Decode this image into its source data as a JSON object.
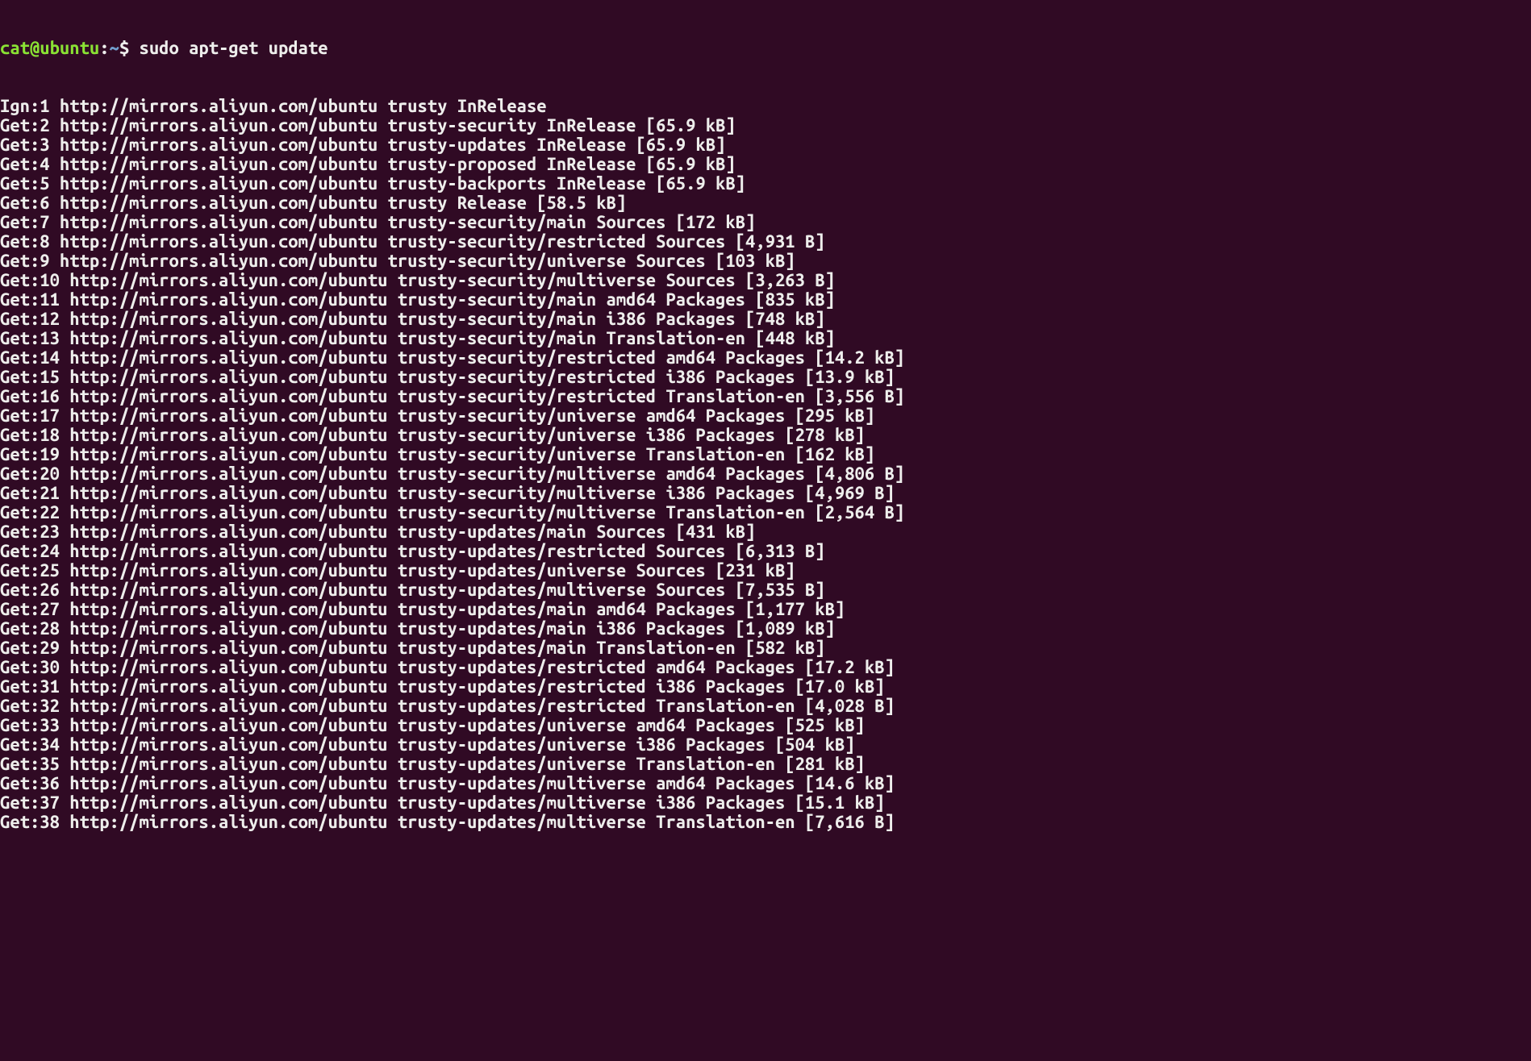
{
  "prompt": {
    "user": "cat",
    "at": "@",
    "host": "ubuntu",
    "colon": ":",
    "path": "~",
    "dollar": "$ ",
    "command": "sudo apt-get update"
  },
  "lines": [
    "Ign:1 http://mirrors.aliyun.com/ubuntu trusty InRelease",
    "Get:2 http://mirrors.aliyun.com/ubuntu trusty-security InRelease [65.9 kB]",
    "Get:3 http://mirrors.aliyun.com/ubuntu trusty-updates InRelease [65.9 kB]",
    "Get:4 http://mirrors.aliyun.com/ubuntu trusty-proposed InRelease [65.9 kB]",
    "Get:5 http://mirrors.aliyun.com/ubuntu trusty-backports InRelease [65.9 kB]",
    "Get:6 http://mirrors.aliyun.com/ubuntu trusty Release [58.5 kB]",
    "Get:7 http://mirrors.aliyun.com/ubuntu trusty-security/main Sources [172 kB]",
    "Get:8 http://mirrors.aliyun.com/ubuntu trusty-security/restricted Sources [4,931 B]",
    "Get:9 http://mirrors.aliyun.com/ubuntu trusty-security/universe Sources [103 kB]",
    "Get:10 http://mirrors.aliyun.com/ubuntu trusty-security/multiverse Sources [3,263 B]",
    "Get:11 http://mirrors.aliyun.com/ubuntu trusty-security/main amd64 Packages [835 kB]",
    "Get:12 http://mirrors.aliyun.com/ubuntu trusty-security/main i386 Packages [748 kB]",
    "Get:13 http://mirrors.aliyun.com/ubuntu trusty-security/main Translation-en [448 kB]",
    "Get:14 http://mirrors.aliyun.com/ubuntu trusty-security/restricted amd64 Packages [14.2 kB]",
    "Get:15 http://mirrors.aliyun.com/ubuntu trusty-security/restricted i386 Packages [13.9 kB]",
    "Get:16 http://mirrors.aliyun.com/ubuntu trusty-security/restricted Translation-en [3,556 B]",
    "Get:17 http://mirrors.aliyun.com/ubuntu trusty-security/universe amd64 Packages [295 kB]",
    "Get:18 http://mirrors.aliyun.com/ubuntu trusty-security/universe i386 Packages [278 kB]",
    "Get:19 http://mirrors.aliyun.com/ubuntu trusty-security/universe Translation-en [162 kB]",
    "Get:20 http://mirrors.aliyun.com/ubuntu trusty-security/multiverse amd64 Packages [4,806 B]",
    "Get:21 http://mirrors.aliyun.com/ubuntu trusty-security/multiverse i386 Packages [4,969 B]",
    "Get:22 http://mirrors.aliyun.com/ubuntu trusty-security/multiverse Translation-en [2,564 B]",
    "Get:23 http://mirrors.aliyun.com/ubuntu trusty-updates/main Sources [431 kB]",
    "Get:24 http://mirrors.aliyun.com/ubuntu trusty-updates/restricted Sources [6,313 B]",
    "Get:25 http://mirrors.aliyun.com/ubuntu trusty-updates/universe Sources [231 kB]",
    "Get:26 http://mirrors.aliyun.com/ubuntu trusty-updates/multiverse Sources [7,535 B]",
    "Get:27 http://mirrors.aliyun.com/ubuntu trusty-updates/main amd64 Packages [1,177 kB]",
    "Get:28 http://mirrors.aliyun.com/ubuntu trusty-updates/main i386 Packages [1,089 kB]",
    "Get:29 http://mirrors.aliyun.com/ubuntu trusty-updates/main Translation-en [582 kB]",
    "Get:30 http://mirrors.aliyun.com/ubuntu trusty-updates/restricted amd64 Packages [17.2 kB]",
    "Get:31 http://mirrors.aliyun.com/ubuntu trusty-updates/restricted i386 Packages [17.0 kB]",
    "Get:32 http://mirrors.aliyun.com/ubuntu trusty-updates/restricted Translation-en [4,028 B]",
    "Get:33 http://mirrors.aliyun.com/ubuntu trusty-updates/universe amd64 Packages [525 kB]",
    "Get:34 http://mirrors.aliyun.com/ubuntu trusty-updates/universe i386 Packages [504 kB]",
    "Get:35 http://mirrors.aliyun.com/ubuntu trusty-updates/universe Translation-en [281 kB]",
    "Get:36 http://mirrors.aliyun.com/ubuntu trusty-updates/multiverse amd64 Packages [14.6 kB]",
    "Get:37 http://mirrors.aliyun.com/ubuntu trusty-updates/multiverse i386 Packages [15.1 kB]",
    "Get:38 http://mirrors.aliyun.com/ubuntu trusty-updates/multiverse Translation-en [7,616 B]"
  ]
}
